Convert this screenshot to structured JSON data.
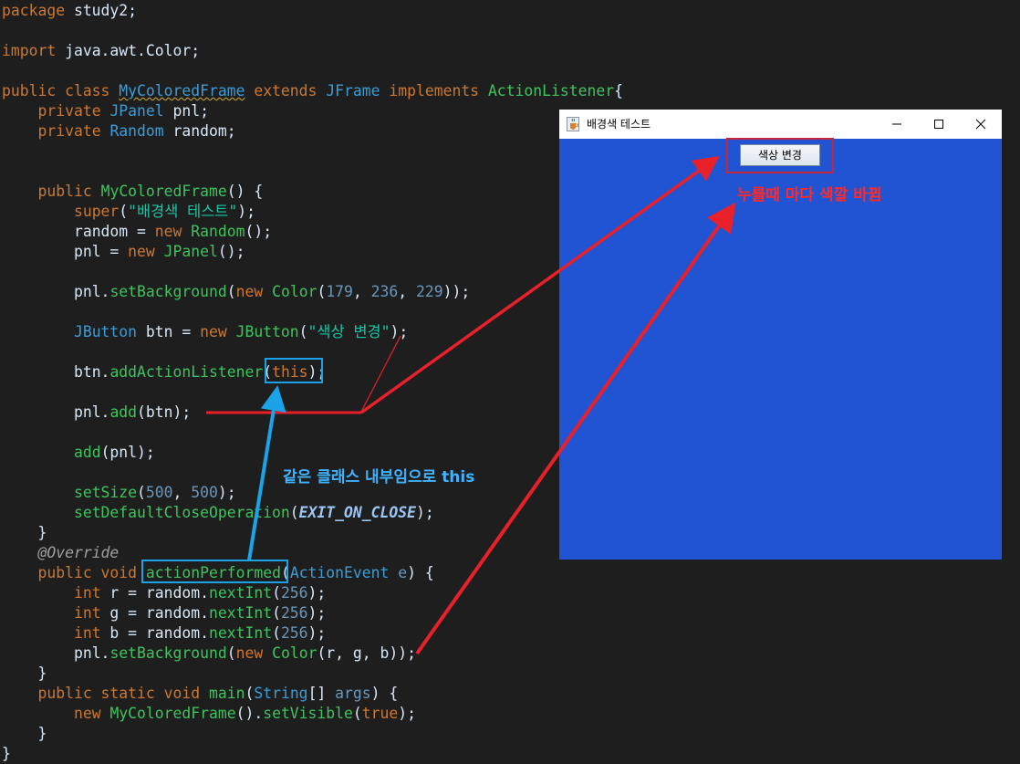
{
  "code": {
    "l_package": [
      "package",
      " study2;"
    ],
    "l_import": [
      "import",
      " java.awt.Color;"
    ],
    "l_class": [
      "public class",
      " ",
      "MyColoredFrame",
      " ",
      "extends",
      " ",
      "JFrame",
      " ",
      "implements",
      " ",
      "ActionListener",
      "{"
    ],
    "l_field1": [
      "    ",
      "private",
      " ",
      "JPanel",
      " pnl;"
    ],
    "l_field2": [
      "    ",
      "private",
      " ",
      "Random",
      " random;"
    ],
    "l_ctor": [
      "    ",
      "public",
      " ",
      "MyColoredFrame",
      "() {"
    ],
    "l_super": [
      "        ",
      "super",
      "(",
      "\"배경색 테스트\"",
      ");"
    ],
    "l_random": [
      "        ",
      "random = ",
      "new",
      " ",
      "Random",
      "();"
    ],
    "l_pnl": [
      "        ",
      "pnl = ",
      "new",
      " ",
      "JPanel",
      "();"
    ],
    "l_setbg": [
      "        ",
      "pnl.",
      "setBackground",
      "(",
      "new",
      " ",
      "Color",
      "(",
      "179",
      ", ",
      "236",
      ", ",
      "229",
      "));"
    ],
    "l_btn": [
      "        ",
      "JButton",
      " btn = ",
      "new",
      " ",
      "JButton",
      "(",
      "\"색상 변경\"",
      ");"
    ],
    "l_addlistener": [
      "        ",
      "btn.",
      "addActionListener",
      "(",
      "this",
      ");"
    ],
    "l_pnladd": [
      "        ",
      "pnl.",
      "add",
      "(btn);"
    ],
    "l_add": [
      "        ",
      "add",
      "(pnl);"
    ],
    "l_setsize": [
      "        ",
      "setSize",
      "(",
      "500",
      ", ",
      "500",
      ");"
    ],
    "l_close": [
      "        ",
      "setDefaultCloseOperation",
      "(",
      "EXIT_ON_CLOSE",
      ");"
    ],
    "l_brace1": [
      "    ",
      "}"
    ],
    "l_override": [
      "    ",
      "@Override"
    ],
    "l_action": [
      "    ",
      "public void",
      " ",
      "actionPerformed",
      "(",
      "ActionEvent",
      " ",
      "e",
      ") {"
    ],
    "l_r": [
      "        ",
      "int",
      " r = random.",
      "nextInt",
      "(",
      "256",
      ");"
    ],
    "l_g": [
      "        ",
      "int",
      " g = random.",
      "nextInt",
      "(",
      "256",
      ");"
    ],
    "l_b": [
      "        ",
      "int",
      " b = random.",
      "nextInt",
      "(",
      "256",
      ");"
    ],
    "l_setbg2": [
      "        ",
      "pnl.",
      "setBackground",
      "(",
      "new",
      " ",
      "Color",
      "(r, g, b));"
    ],
    "l_brace2": [
      "    ",
      "}"
    ],
    "l_main": [
      "    ",
      "public static void",
      " ",
      "main",
      "(",
      "String",
      "[] ",
      "args",
      ") {"
    ],
    "l_newframe": [
      "        ",
      "new",
      " ",
      "MyColoredFrame",
      "().",
      "setVisible",
      "(",
      "true",
      ");"
    ],
    "l_brace3": [
      "    ",
      "}"
    ],
    "l_brace4": [
      "}"
    ]
  },
  "window": {
    "title": "배경색 테스트",
    "button_label": "색상 변경",
    "panel_color": "#2054d2",
    "minimize_icon": "minimize-icon",
    "maximize_icon": "maximize-icon",
    "close_icon": "close-icon",
    "app_icon": "java-cup-icon"
  },
  "annotations": {
    "red_note": "누를때 마다 색깔 바뀜",
    "blue_note": "같은 클래스 내부임으로 this",
    "red_color": "#e8202a",
    "blue_color": "#1aa3e8"
  }
}
